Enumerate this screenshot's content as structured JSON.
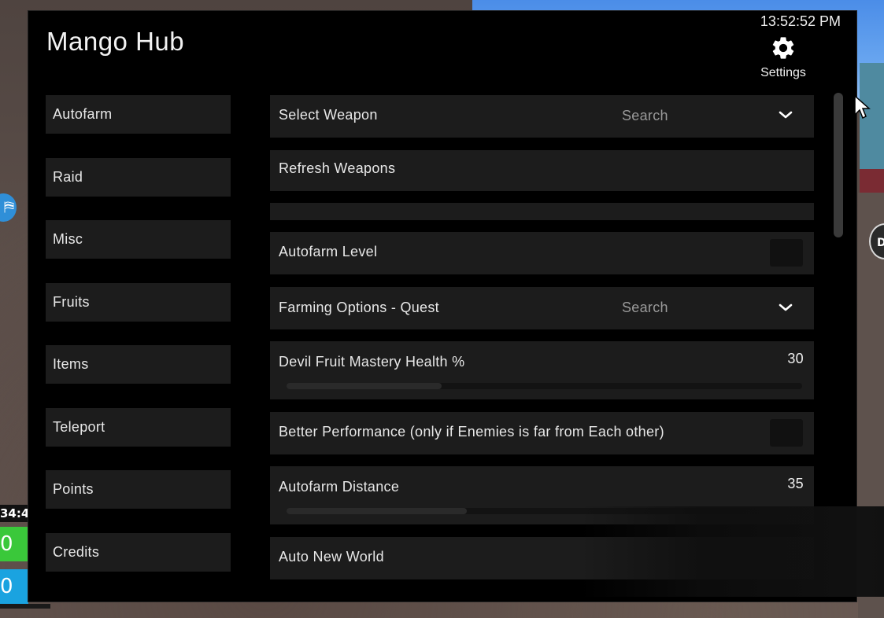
{
  "app": {
    "title": "Mango Hub",
    "clock": "13:52:52 PM",
    "settings_label": "Settings"
  },
  "sidebar": {
    "items": [
      {
        "label": "Autofarm"
      },
      {
        "label": "Raid"
      },
      {
        "label": "Misc"
      },
      {
        "label": "Fruits"
      },
      {
        "label": "Items"
      },
      {
        "label": "Teleport"
      },
      {
        "label": "Points"
      },
      {
        "label": "Credits"
      }
    ]
  },
  "content": {
    "select_weapon": {
      "label": "Select Weapon",
      "search_placeholder": "Search"
    },
    "refresh_weapons": {
      "label": "Refresh Weapons"
    },
    "autofarm_level": {
      "label": "Autofarm Level",
      "enabled": false
    },
    "farming_options": {
      "label": "Farming Options - Quest",
      "search_placeholder": "Search"
    },
    "devil_fruit_mastery": {
      "label": "Devil Fruit Mastery Health %",
      "value": "30",
      "fill_fraction": 0.3
    },
    "better_performance": {
      "label": "Better Performance (only if Enemies is far from Each other)",
      "enabled": false
    },
    "autofarm_distance": {
      "label": "Autofarm Distance",
      "value": "35",
      "fill_fraction": 0.35
    },
    "auto_new_world": {
      "label": "Auto New World"
    }
  },
  "hud": {
    "time_fragment": "34:4",
    "green_value": "0",
    "blue_value": "0",
    "right_badge": "D"
  },
  "colors": {
    "window_bg": "#000000",
    "panel_bg": "#1c1c1c",
    "accent_text": "#e8e8e8",
    "muted_text": "#9a9a9a"
  }
}
